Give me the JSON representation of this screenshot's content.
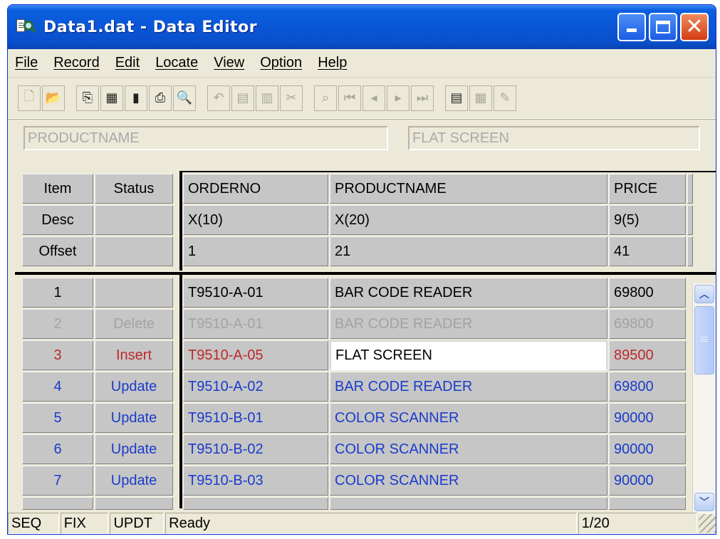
{
  "window": {
    "title": "Data1.dat - Data Editor"
  },
  "menu": [
    "File",
    "Record",
    "Edit",
    "Locate",
    "View",
    "Option",
    "Help"
  ],
  "toolbar_icons": [
    {
      "name": "new-file-icon",
      "glyph": "🗋",
      "enabled": false
    },
    {
      "name": "open-folder-icon",
      "glyph": "📂",
      "enabled": false
    },
    {
      "name": "copy-record-icon",
      "glyph": "⎘",
      "enabled": true
    },
    {
      "name": "import-icon",
      "glyph": "▦",
      "enabled": true
    },
    {
      "name": "bookmark-icon",
      "glyph": "▮",
      "enabled": true
    },
    {
      "name": "print-icon",
      "glyph": "⎙",
      "enabled": true
    },
    {
      "name": "print-preview-icon",
      "glyph": "🔍",
      "enabled": true
    },
    {
      "name": "undo-icon",
      "glyph": "↶",
      "enabled": false
    },
    {
      "name": "insert-record-icon",
      "glyph": "▤",
      "enabled": false
    },
    {
      "name": "delete-record-icon",
      "glyph": "▥",
      "enabled": false
    },
    {
      "name": "cut-icon",
      "glyph": "✂",
      "enabled": false
    },
    {
      "name": "find-icon",
      "glyph": "⌕",
      "enabled": false
    },
    {
      "name": "first-record-icon",
      "glyph": "⏮",
      "enabled": false
    },
    {
      "name": "prev-record-icon",
      "glyph": "◂",
      "enabled": false
    },
    {
      "name": "next-record-icon",
      "glyph": "▸",
      "enabled": false
    },
    {
      "name": "last-record-icon",
      "glyph": "⏭",
      "enabled": false
    },
    {
      "name": "record-view-icon",
      "glyph": "▤",
      "enabled": true
    },
    {
      "name": "table-view-icon",
      "glyph": "▦",
      "enabled": false
    },
    {
      "name": "settings-icon",
      "glyph": "✎",
      "enabled": false
    }
  ],
  "field_bar": {
    "field_name": "PRODUCTNAME",
    "field_value": "FLAT SCREEN"
  },
  "left_headers": {
    "item": "Item",
    "status": "Status",
    "desc": "Desc",
    "offset": "Offset"
  },
  "columns": [
    {
      "name": "ORDERNO",
      "desc": "X(10)",
      "offset": "1"
    },
    {
      "name": "PRODUCTNAME",
      "desc": "X(20)",
      "offset": "21"
    },
    {
      "name": "PRICE",
      "desc": "9(5)",
      "offset": "41"
    }
  ],
  "rows": [
    {
      "item": "1",
      "status": "",
      "orderno": "T9510-A-01",
      "productname": "BAR CODE READER",
      "price": "69800",
      "color": "black"
    },
    {
      "item": "2",
      "status": "Delete",
      "orderno": "T9510-A-01",
      "productname": "BAR CODE READER",
      "price": "69800",
      "color": "gray"
    },
    {
      "item": "3",
      "status": "Insert",
      "orderno": "T9510-A-05",
      "productname": "FLAT SCREEN",
      "price": "89500",
      "color": "red",
      "editing": true
    },
    {
      "item": "4",
      "status": "Update",
      "orderno": "T9510-A-02",
      "productname": "BAR CODE READER",
      "price": "69800",
      "color": "blue"
    },
    {
      "item": "5",
      "status": "Update",
      "orderno": "T9510-B-01",
      "productname": "COLOR SCANNER",
      "price": "90000",
      "color": "blue"
    },
    {
      "item": "6",
      "status": "Update",
      "orderno": "T9510-B-02",
      "productname": "COLOR SCANNER",
      "price": "90000",
      "color": "blue"
    },
    {
      "item": "7",
      "status": "Update",
      "orderno": "T9510-B-03",
      "productname": "COLOR SCANNER",
      "price": "90000",
      "color": "blue"
    }
  ],
  "status_bar": {
    "seq": "SEQ",
    "fix": "FIX",
    "updt": "UPDT",
    "message": "Ready",
    "position": "1/20"
  },
  "colors": {
    "title_bar": "#0a56d6",
    "insert_text": "#bc2a2a",
    "update_text": "#1a3ccb",
    "delete_text": "#a3a3a3",
    "cell_bg": "#c6c6c6"
  }
}
